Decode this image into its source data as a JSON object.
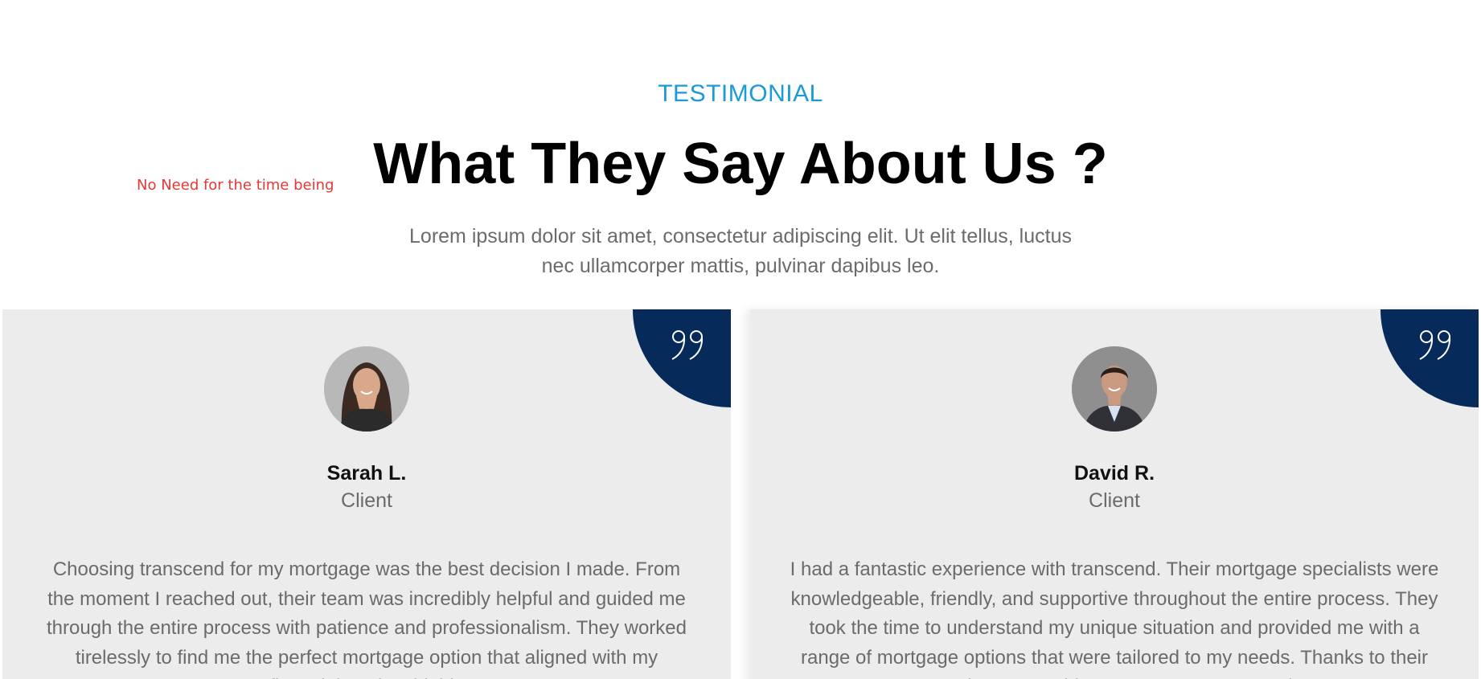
{
  "header": {
    "eyebrow": "TESTIMONIAL",
    "title": "What They Say About Us ?",
    "subtitle_line1": "Lorem ipsum dolor sit amet, consectetur adipiscing elit. Ut elit tellus, luctus",
    "subtitle_line2": "nec ullamcorper mattis, pulvinar dapibus leo."
  },
  "annotation": "No Need for the time being",
  "colors": {
    "accent": "#1a9ad6",
    "quote_badge": "#062b5a",
    "card_bg": "#ececec",
    "annotation": "#e53935"
  },
  "testimonials": [
    {
      "name": "Sarah L.",
      "role": "Client",
      "text": "Choosing transcend for my mortgage was the best decision I made. From the moment I reached out, their team was incredibly helpful and guided me through the entire process with patience and professionalism. They worked tirelessly to find me the perfect mortgage option that aligned with my financial goals. I highly",
      "avatar_icon": "woman-avatar"
    },
    {
      "name": "David R.",
      "role": "Client",
      "text": "I had a fantastic experience with transcend. Their mortgage specialists were knowledgeable, friendly, and supportive throughout the entire process. They took the time to understand my unique situation and provided me with a range of mortgage options that were tailored to my needs. Thanks to their expertise, I was able to secure a mortgage that",
      "avatar_icon": "man-avatar"
    }
  ]
}
